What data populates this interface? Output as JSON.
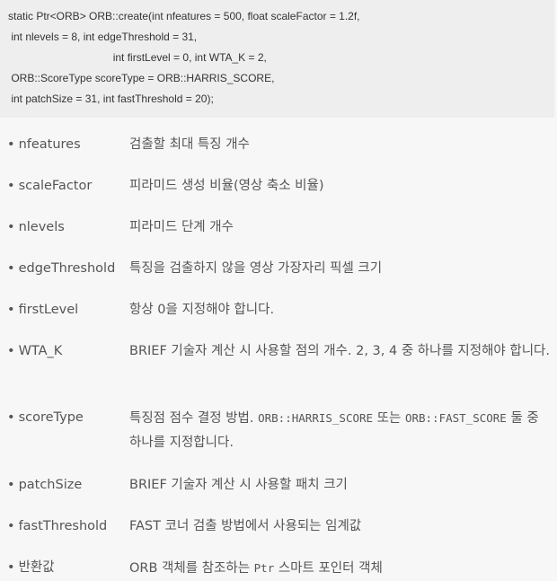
{
  "code": {
    "lines": [
      "static Ptr<ORB> ORB::create(int nfeatures = 500, float scaleFactor = 1.2f,",
      " int nlevels = 8, int edgeThreshold = 31,",
      "                                   int firstLevel = 0, int WTA_K = 2,",
      " ORB::ScoreType scoreType = ORB::HARRIS_SCORE,",
      " int patchSize = 31, int fastThreshold = 20);"
    ]
  },
  "bullet": "•",
  "params": [
    {
      "name": "nfeatures",
      "desc": "검출할 최대 특징 개수"
    },
    {
      "name": "scaleFactor",
      "desc": "피라미드 생성 비율(영상 축소 비율)"
    },
    {
      "name": "nlevels",
      "desc": "피라미드 단계 개수"
    },
    {
      "name": "edgeThreshold",
      "desc": "특징을 검출하지 않을 영상 가장자리 픽셀 크기"
    },
    {
      "name": "firstLevel",
      "desc": "항상 0을 지정해야 합니다."
    },
    {
      "name": "WTA_K",
      "desc": "BRIEF 기술자 계산 시 사용할 점의 개수. 2, 3, 4 중 하나를 지정해야 합니다."
    },
    {
      "name": "scoreType",
      "desc_pre": "특징점 점수 결정 방법. ",
      "code1": "ORB::HARRIS_SCORE",
      "desc_mid": " 또는 ",
      "code2": "ORB::FAST_SCORE",
      "desc_post": " 둘 중 하나를 지정합니다."
    },
    {
      "name": "patchSize",
      "desc": "BRIEF 기술자 계산 시 사용할 패치 크기"
    },
    {
      "name": "fastThreshold",
      "desc": "FAST 코너 검출 방법에서 사용되는 임계값"
    },
    {
      "name": "반환값",
      "desc_pre": "ORB 객체를 참조하는 ",
      "code1": "Ptr",
      "desc_post": " 스마트 포인터 객체"
    }
  ]
}
